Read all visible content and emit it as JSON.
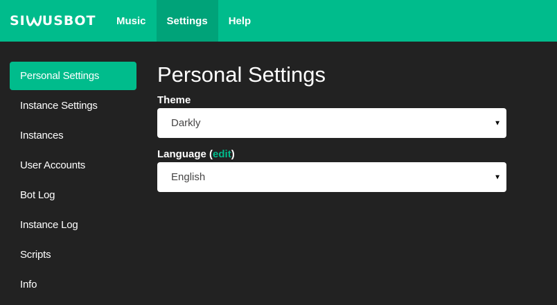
{
  "brand": {
    "text_before": "SI",
    "text_after": "USBOT",
    "logo_icon": "wave-w-icon"
  },
  "nav": {
    "items": [
      {
        "label": "Music",
        "active": false
      },
      {
        "label": "Settings",
        "active": true
      },
      {
        "label": "Help",
        "active": false
      }
    ]
  },
  "sidebar": {
    "items": [
      {
        "label": "Personal Settings",
        "active": true
      },
      {
        "label": "Instance Settings",
        "active": false
      },
      {
        "label": "Instances",
        "active": false
      },
      {
        "label": "User Accounts",
        "active": false
      },
      {
        "label": "Bot Log",
        "active": false
      },
      {
        "label": "Instance Log",
        "active": false
      },
      {
        "label": "Scripts",
        "active": false
      },
      {
        "label": "Info",
        "active": false
      }
    ]
  },
  "main": {
    "title": "Personal Settings",
    "theme": {
      "label": "Theme",
      "value": "Darkly"
    },
    "language": {
      "label_prefix": "Language (",
      "edit_link": "edit",
      "label_suffix": ")",
      "value": "English"
    }
  },
  "colors": {
    "accent": "#00bc8c",
    "accent_dark": "#00a379",
    "background": "#222222"
  }
}
